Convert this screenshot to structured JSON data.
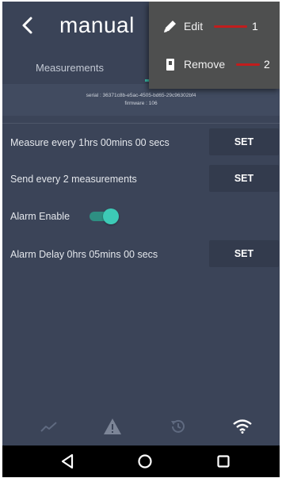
{
  "appbar": {
    "title": "manual",
    "back_icon": "chevron-left-icon"
  },
  "tabs": [
    {
      "label": "Measurements"
    }
  ],
  "info": {
    "serial": "serial : 36371c8b-e5ac-4505-bd65-29c96302bf4",
    "firmware": "firmware : 106"
  },
  "settings": [
    {
      "label": "Measure every 1hrs 00mins 00 secs",
      "button": "SET"
    },
    {
      "label": "Send every 2 measurements",
      "button": "SET"
    },
    {
      "label": "Alarm Enable",
      "toggle_on": true
    },
    {
      "label": "Alarm Delay 0hrs 05mins 00 secs",
      "button": "SET"
    }
  ],
  "menu": {
    "items": [
      {
        "label": "Edit",
        "icon": "pencil-icon",
        "annotation": "1"
      },
      {
        "label": "Remove",
        "icon": "trash-icon",
        "annotation": "2"
      }
    ]
  },
  "bottom_nav": [
    "chart-icon",
    "warning-icon",
    "history-icon",
    "wifi-icon"
  ],
  "system_nav": [
    "back-triangle-icon",
    "home-circle-icon",
    "recents-square-icon"
  ],
  "colors": {
    "background": "#3b4458",
    "accent": "#36b3a0",
    "menu": "#4e4f4f",
    "annotation": "#c21d1d"
  }
}
